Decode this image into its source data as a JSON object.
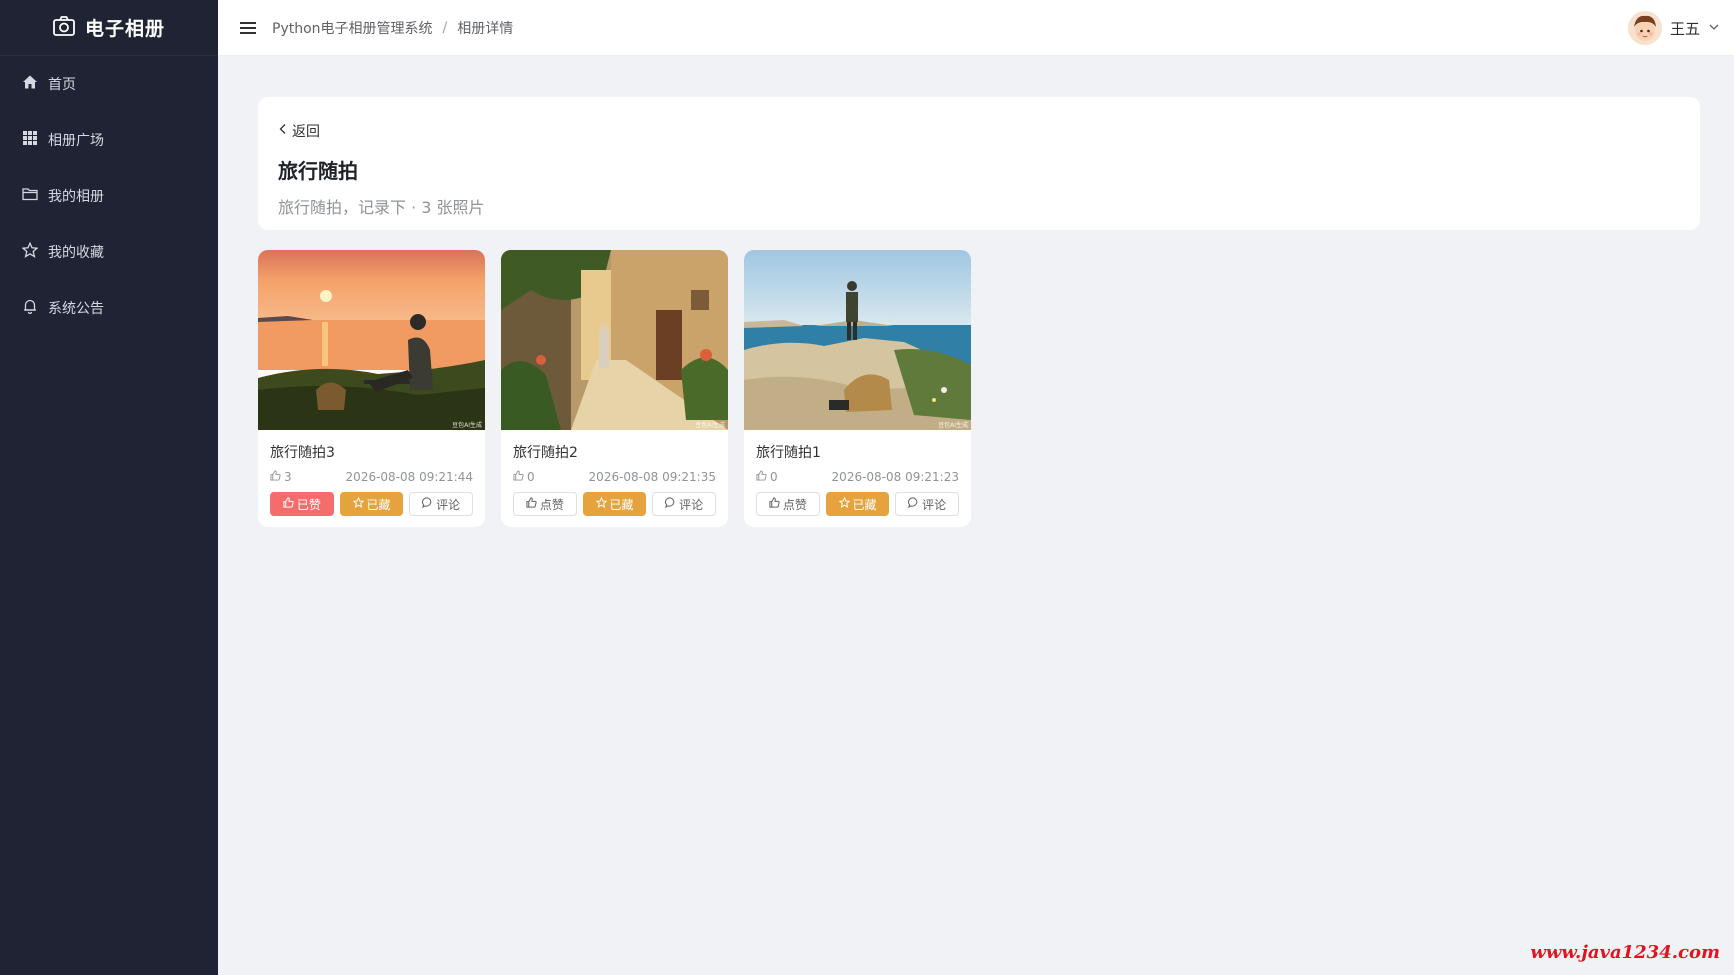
{
  "app": {
    "title": "电子相册"
  },
  "sidebar": {
    "items": [
      {
        "label": "首页",
        "icon": "home-icon"
      },
      {
        "label": "相册广场",
        "icon": "grid-icon"
      },
      {
        "label": "我的相册",
        "icon": "folder-icon"
      },
      {
        "label": "我的收藏",
        "icon": "star-icon"
      },
      {
        "label": "系统公告",
        "icon": "bell-icon"
      }
    ]
  },
  "header": {
    "breadcrumb": [
      "Python电子相册管理系统",
      "相册详情"
    ],
    "breadcrumb_separator": "/",
    "user_name": "王五"
  },
  "album": {
    "back_label": "返回",
    "title": "旅行随拍",
    "description": "旅行随拍，记录下 · 3 张照片"
  },
  "photos": [
    {
      "name": "旅行随拍3",
      "likes": "3",
      "time": "2026-08-08 09:21:44",
      "like_label": "已赞",
      "liked": true,
      "fav_label": "已藏",
      "comment_label": "评论",
      "watermark": "豆包AI生成"
    },
    {
      "name": "旅行随拍2",
      "likes": "0",
      "time": "2026-08-08 09:21:35",
      "like_label": "点赞",
      "liked": false,
      "fav_label": "已藏",
      "comment_label": "评论",
      "watermark": "豆包AI生成"
    },
    {
      "name": "旅行随拍1",
      "likes": "0",
      "time": "2026-08-08 09:21:23",
      "like_label": "点赞",
      "liked": false,
      "fav_label": "已藏",
      "comment_label": "评论",
      "watermark": "豆包AI生成"
    }
  ],
  "watermark": "www.java1234.com",
  "colors": {
    "sidebar_bg": "#1f2333",
    "liked": "#f56c6c",
    "favorited": "#e6a23c",
    "page_bg": "#f0f2f5"
  }
}
